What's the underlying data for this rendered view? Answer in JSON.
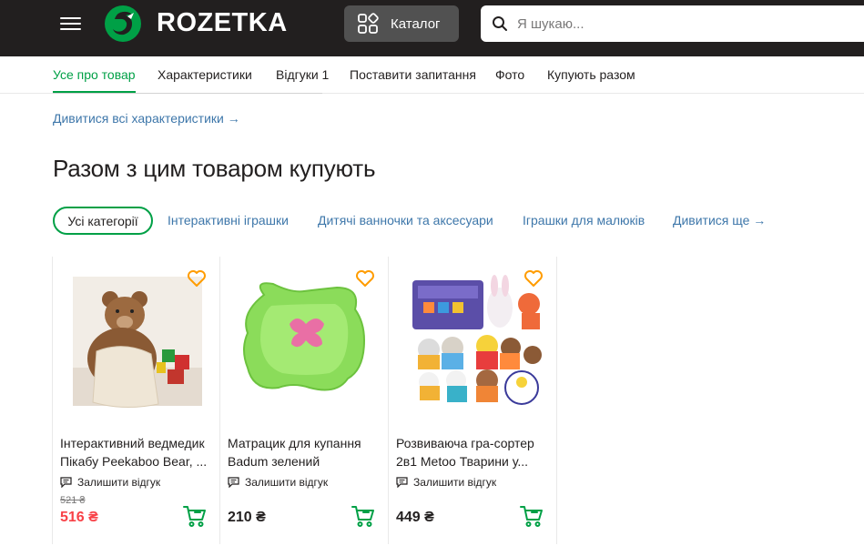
{
  "header": {
    "logo_text": "ROZETKA",
    "catalog_label": "Каталог",
    "search_placeholder": "Я шукаю..."
  },
  "tabs": [
    {
      "label": "Усе про товар",
      "active": true
    },
    {
      "label": "Характеристики"
    },
    {
      "label": "Відгуки 1"
    },
    {
      "label": "Поставити запитання"
    },
    {
      "label": "Фото"
    },
    {
      "label": "Купують разом"
    }
  ],
  "all_specs_link": "Дивитися всі характеристики →",
  "section_title": "Разом з цим товаром купують",
  "categories": {
    "active": "Усі категорії",
    "items": [
      "Інтерактивні іграшки",
      "Дитячі ванночки та аксесуари",
      "Іграшки для малюків",
      "Дивитися ще →"
    ]
  },
  "products": [
    {
      "title": "Інтерактивний ведмедик Пікабу Peekaboo Bear, ...",
      "review_label": "Залишити відгук",
      "old_price": "521 ₴",
      "price": "516 ₴",
      "price_icon": "bear-toy-image"
    },
    {
      "title": "Матрацик для купання Badum зелений",
      "review_label": "Залишити відгук",
      "price": "210 ₴",
      "price_icon": "bath-mat-image"
    },
    {
      "title": "Розвиваюча гра-сортер 2в1 Metoo Тварини у...",
      "review_label": "Залишити відгук",
      "price": "449 ₴",
      "price_icon": "sorter-toy-image"
    }
  ],
  "colors": {
    "brand_green": "#00a046",
    "header_bg": "#221f1f",
    "link_blue": "#3e77aa",
    "sale_red": "#f84147",
    "wish_orange": "#ff9c00"
  }
}
